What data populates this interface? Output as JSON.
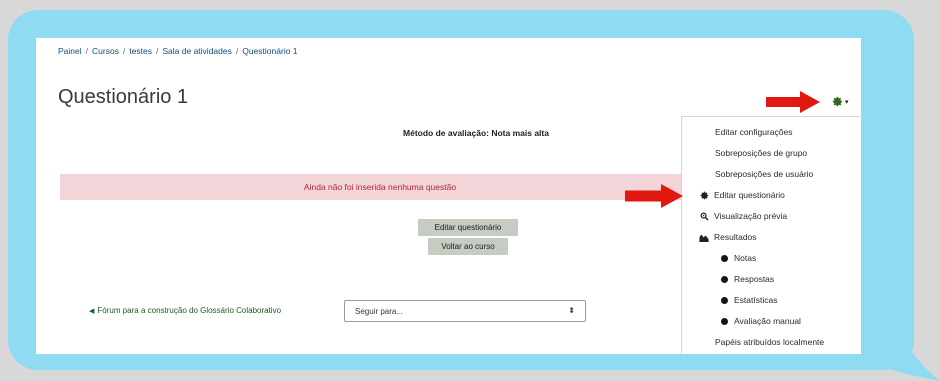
{
  "breadcrumb": [
    "Painel",
    "Cursos",
    "testes",
    "Sala de atividades",
    "Questionário 1"
  ],
  "page_title": "Questionário 1",
  "grading_method": "Método de avaliação: Nota mais alta",
  "alert_text": "Ainda não foi inserida nenhuma questão",
  "buttons": {
    "edit": "Editar questionário",
    "back": "Voltar ao curso"
  },
  "forum_link": "Fórum para a construção do Glossário Colaborativo",
  "jump_select": {
    "value": "Seguir para..."
  },
  "menu": {
    "edit_settings": "Editar configurações",
    "group_overrides": "Sobreposições de grupo",
    "user_overrides": "Sobreposições de usuário",
    "edit_quiz": "Editar questionário",
    "preview": "Visualização prévia",
    "results": "Resultados",
    "grades": "Notas",
    "responses": "Respostas",
    "statistics": "Estatísticas",
    "manual_grading": "Avaliação manual",
    "local_roles": "Papéis atribuídos localmente"
  },
  "colors": {
    "bubble": "#8edbf2",
    "arrow": "#e0180f",
    "alert_bg": "#f3d4d8",
    "button_bg": "#c7ccc2"
  },
  "icons": [
    "gear-icon",
    "caret-down-icon",
    "magnifier-icon",
    "chart-icon",
    "bullet-icon",
    "triangle-left-icon"
  ]
}
